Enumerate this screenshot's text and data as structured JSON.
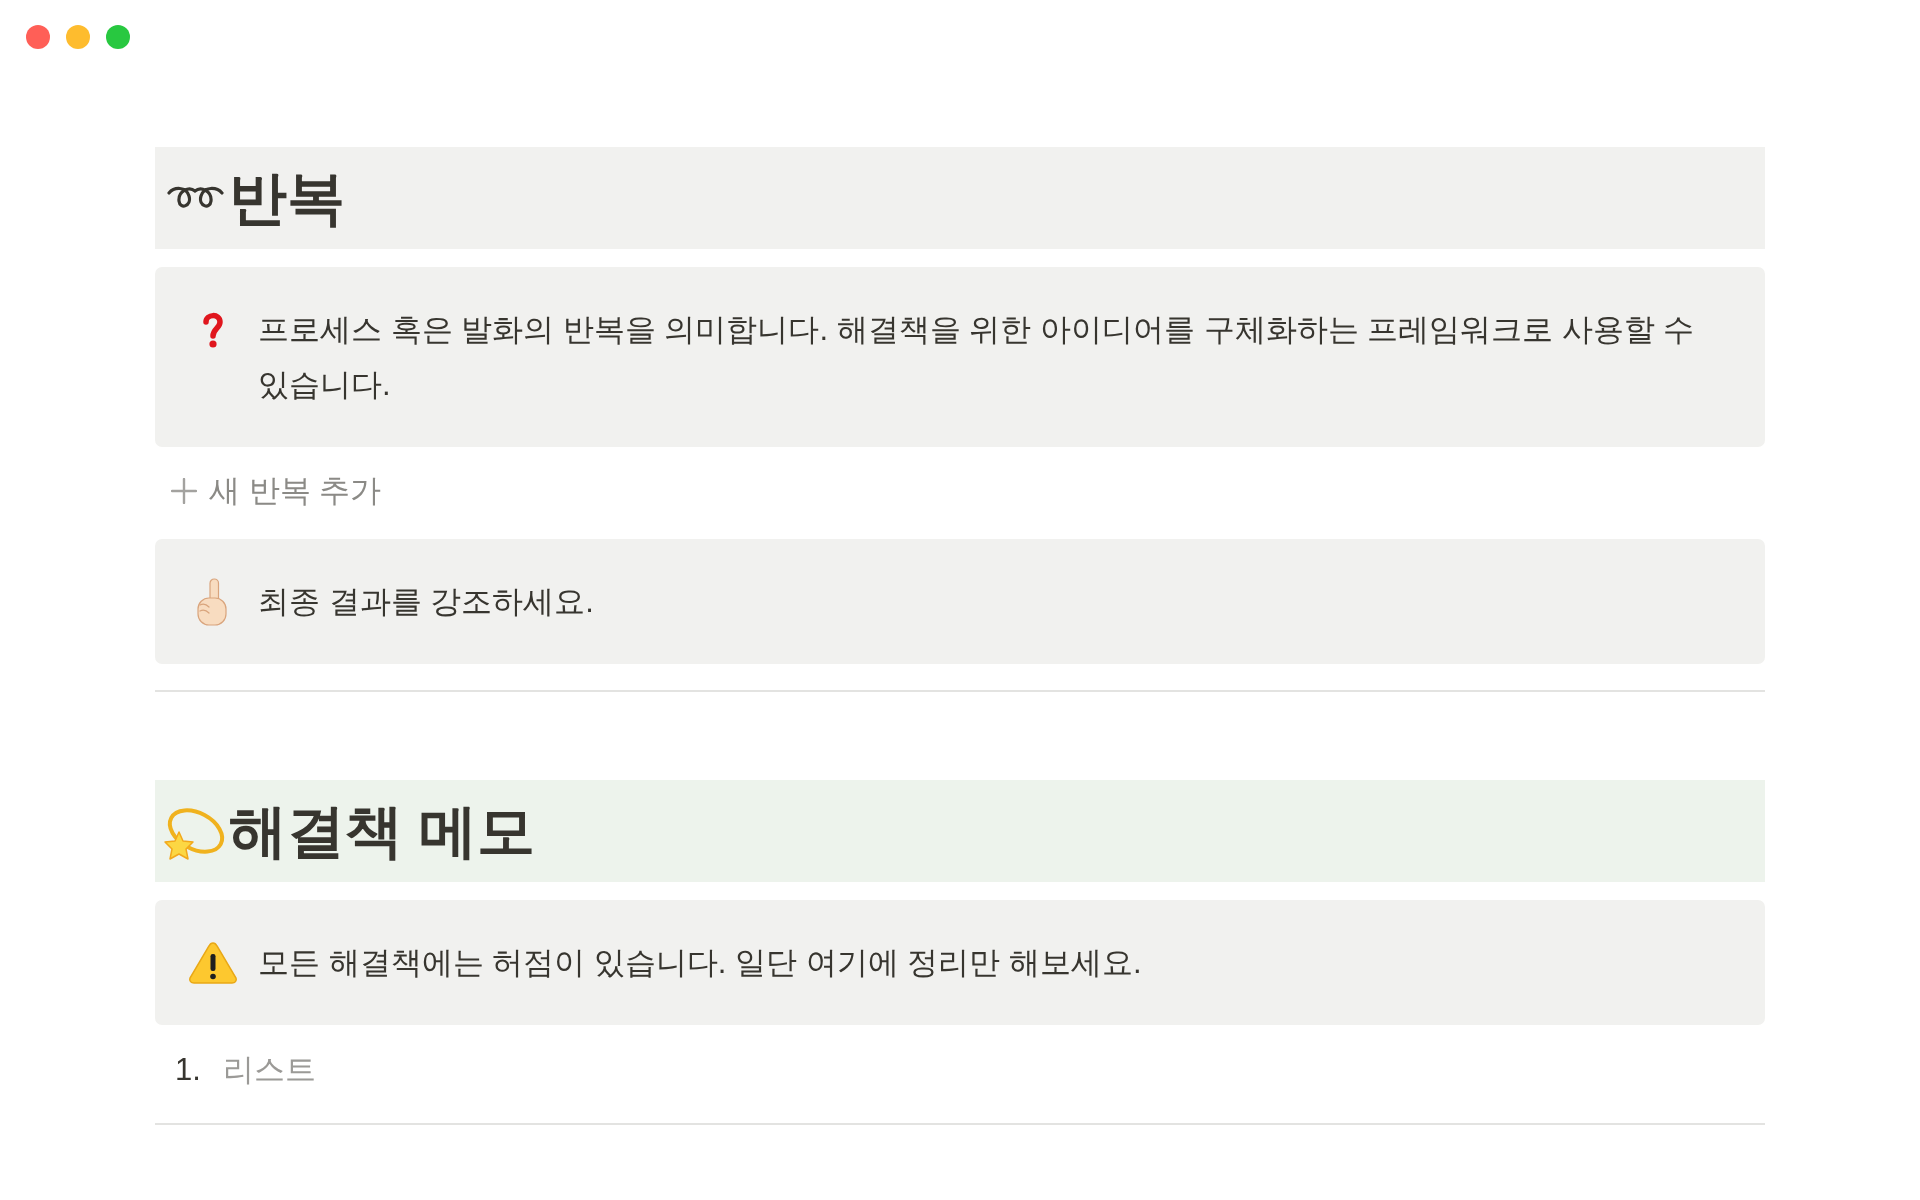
{
  "window_controls": [
    {
      "color": "#ff5f57"
    },
    {
      "color": "#febc2e"
    },
    {
      "color": "#28c840"
    }
  ],
  "sections": [
    {
      "heading": "반복",
      "color": "#f1f1ef",
      "blocks": [
        {
          "kind": "callout",
          "text": "프로세스 혹은 발화의 반복을 의미합니다. 해결책을 위한 아이디어를 구체화하는 프레임워크로 사용할 수 있습니다."
        },
        {
          "kind": "add_button",
          "label": "새 반복 추가"
        },
        {
          "kind": "callout",
          "text": "최종 결과를 강조하세요."
        },
        {
          "kind": "divider"
        }
      ]
    },
    {
      "heading": "해결책 메모",
      "color": "#edf3ec",
      "blocks": [
        {
          "kind": "callout",
          "text": "모든 해결책에는 허점이 있습니다. 일단 여기에 정리만 해보세요."
        },
        {
          "kind": "numbered_list",
          "items": [
            {
              "number": "1.",
              "placeholder": "리스트"
            }
          ]
        },
        {
          "kind": "divider"
        }
      ]
    }
  ]
}
